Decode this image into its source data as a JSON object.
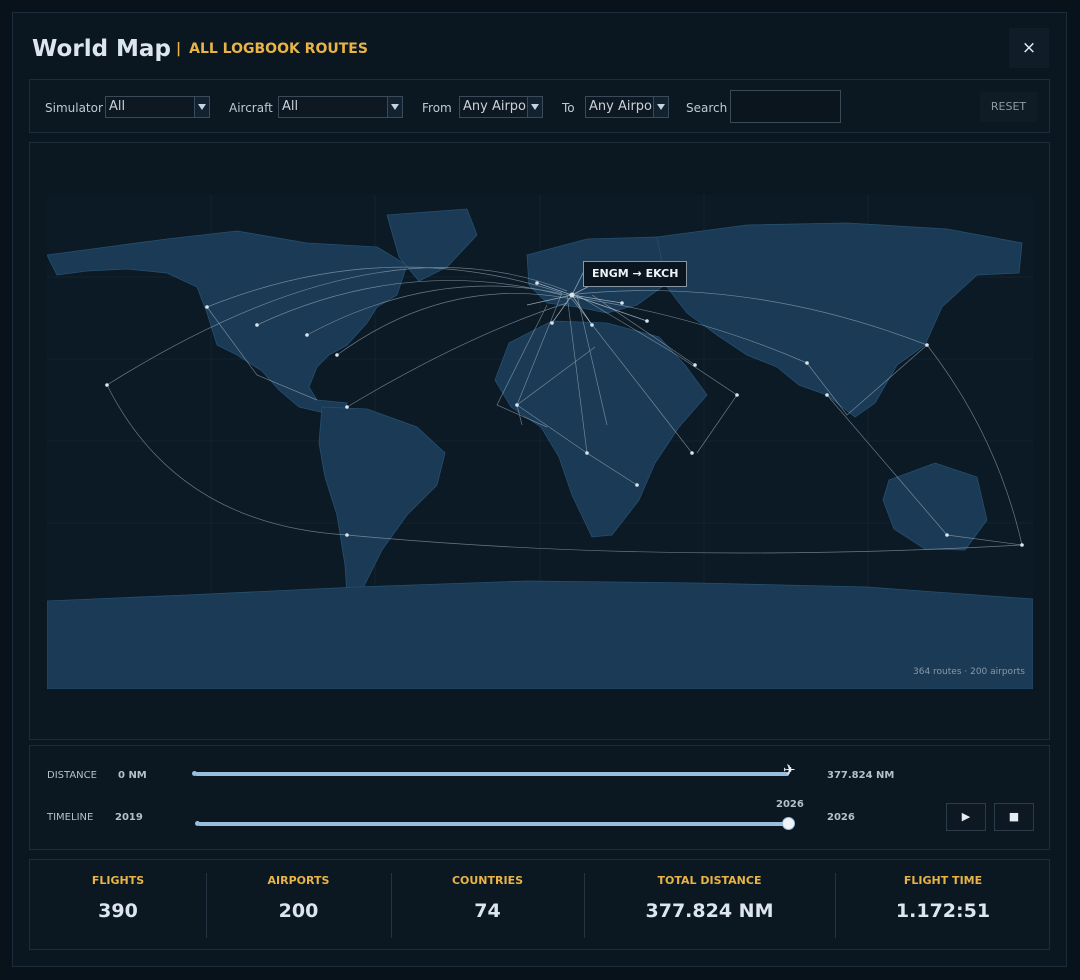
{
  "header": {
    "title": "World Map",
    "subtitle": "ALL LOGBOOK ROUTES",
    "close_label": "×"
  },
  "filters": {
    "simulator": {
      "label": "Simulator",
      "value": "All"
    },
    "aircraft": {
      "label": "Aircraft",
      "value": "All"
    },
    "from": {
      "label": "From",
      "value": "Any Airpor"
    },
    "to": {
      "label": "To",
      "value": "Any Airpor"
    },
    "search": {
      "label": "Search",
      "value": ""
    },
    "reset_label": "RESET"
  },
  "map": {
    "tooltip": "ENGM → EKCH",
    "summary": "364 routes · 200 airports"
  },
  "controls": {
    "distance": {
      "label": "DISTANCE",
      "min": "0 NM",
      "max": "377.824 NM",
      "level": 1.0
    },
    "timeline": {
      "label": "TIMELINE",
      "start": "2019",
      "end": "2026",
      "current": "2026",
      "level": 1.0
    },
    "play_label": "▶",
    "stop_label": "■"
  },
  "stats": [
    {
      "label": "FLIGHTS",
      "value": "390"
    },
    {
      "label": "AIRPORTS",
      "value": "200"
    },
    {
      "label": "COUNTRIES",
      "value": "74"
    },
    {
      "label": "TOTAL DISTANCE",
      "value": "377.824 NM"
    },
    {
      "label": "FLIGHT TIME",
      "value": "1.172:51"
    }
  ],
  "colors": {
    "accent": "#e9b445",
    "land": "#1a3a55",
    "ocean": "#0c1a26",
    "route": "#b8c7d4"
  }
}
